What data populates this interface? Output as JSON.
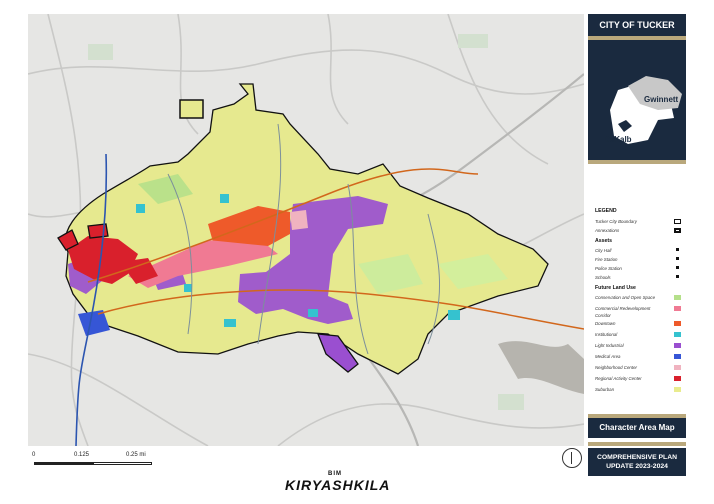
{
  "panel": {
    "title": "CITY OF TUCKER",
    "locator_labels": [
      "Gwinnett",
      "DeKalb"
    ],
    "map_title": "Character Area Map",
    "plan_line1": "COMPREHENSIVE PLAN",
    "plan_line2": "UPDATE 2023-2024"
  },
  "legend": {
    "heading": "LEGEND",
    "boundary": "Tucker City Boundary",
    "annexations": "Annexations",
    "assets_heading": "Assets",
    "assets": [
      "City Hall",
      "Fire Station",
      "Police Station",
      "Schools"
    ],
    "landuse_heading": "Future Land Use",
    "landuse": [
      {
        "label": "Conservation and Open Space",
        "color": "#b5e08a"
      },
      {
        "label": "Commercial Redevelopment Corridor",
        "color": "#f07a93"
      },
      {
        "label": "Downtown",
        "color": "#ee5a2a"
      },
      {
        "label": "Institutional",
        "color": "#35c2cf"
      },
      {
        "label": "Light Industrial",
        "color": "#9a4fd0"
      },
      {
        "label": "Medical Area",
        "color": "#3656d6"
      },
      {
        "label": "Neighborhood Center",
        "color": "#f0b3c0"
      },
      {
        "label": "Regional Activity Center",
        "color": "#d9202c"
      },
      {
        "label": "Suburban",
        "color": "#e9ec8e"
      }
    ]
  },
  "scalebar": {
    "labels": [
      "0",
      "0.125",
      "0.25 mi"
    ]
  },
  "brand": {
    "small": "BIM",
    "name": "KIRYASHKILA"
  }
}
